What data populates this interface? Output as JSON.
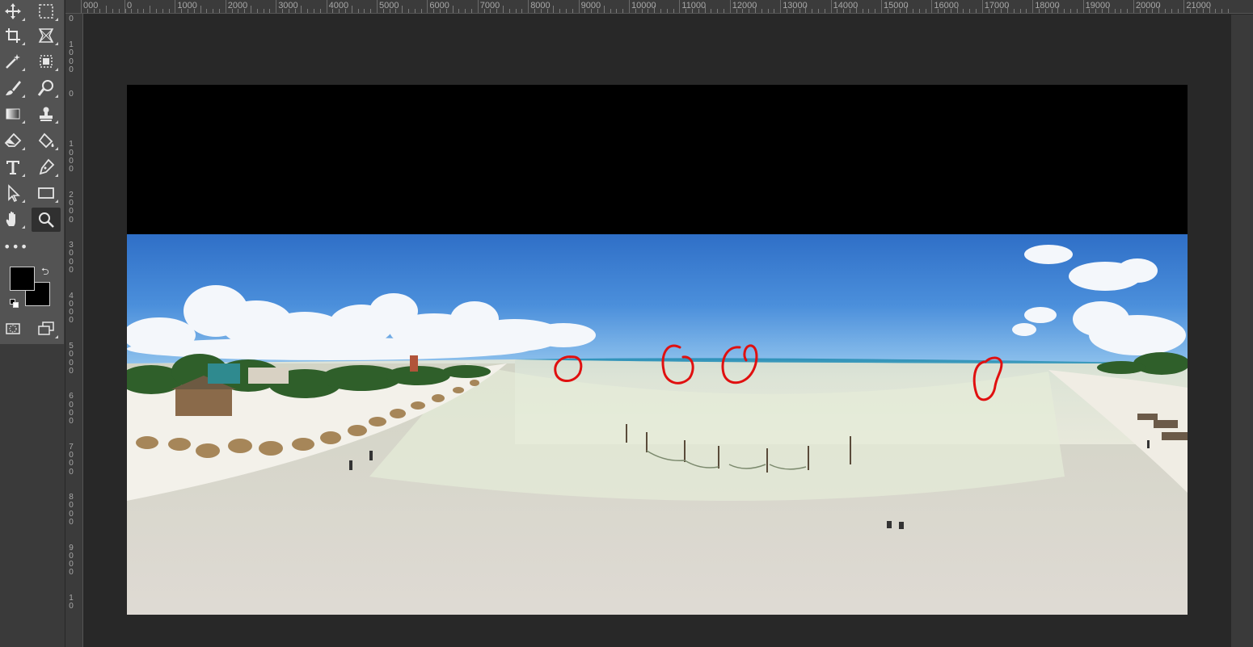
{
  "app": "Photoshop",
  "ruler": {
    "top_labels": [
      "000",
      "0",
      "1000",
      "2000",
      "3000",
      "4000",
      "5000",
      "6000",
      "7000",
      "8000",
      "9000",
      "10000",
      "11000",
      "12000",
      "13000",
      "14000",
      "15000",
      "16000",
      "17000",
      "18000",
      "19000",
      "20000",
      "21000"
    ],
    "left_labels": [
      "0",
      "1000",
      "0",
      "1000",
      "2000",
      "3000",
      "4000",
      "5000",
      "6000",
      "7000",
      "8000",
      "9000",
      "10"
    ]
  },
  "tools": {
    "move": "move-icon",
    "marquee": "rect-marquee-icon",
    "crop": "crop-icon",
    "frame": "frame-icon",
    "magic_wand": "magic-wand-icon",
    "object_select": "object-select-icon",
    "brush": "brush-icon",
    "spot_heal": "spot-heal-icon",
    "gradient": "gradient-icon",
    "stamp": "stamp-icon",
    "eraser": "eraser-icon",
    "paint_bucket": "paint-bucket-icon",
    "type": "type-icon",
    "pen": "pen-icon",
    "path_select": "path-select-icon",
    "rectangle": "rectangle-icon",
    "hand": "hand-icon",
    "zoom": "zoom-icon",
    "active_tool": "zoom"
  },
  "more_tools_label": "•••",
  "colors": {
    "foreground": "#000000",
    "background": "#000000",
    "annotation_stroke": "#e01010"
  },
  "canvas": {
    "image": "panoramic beach photo with red circled marks",
    "letterbox_color": "#000000"
  }
}
